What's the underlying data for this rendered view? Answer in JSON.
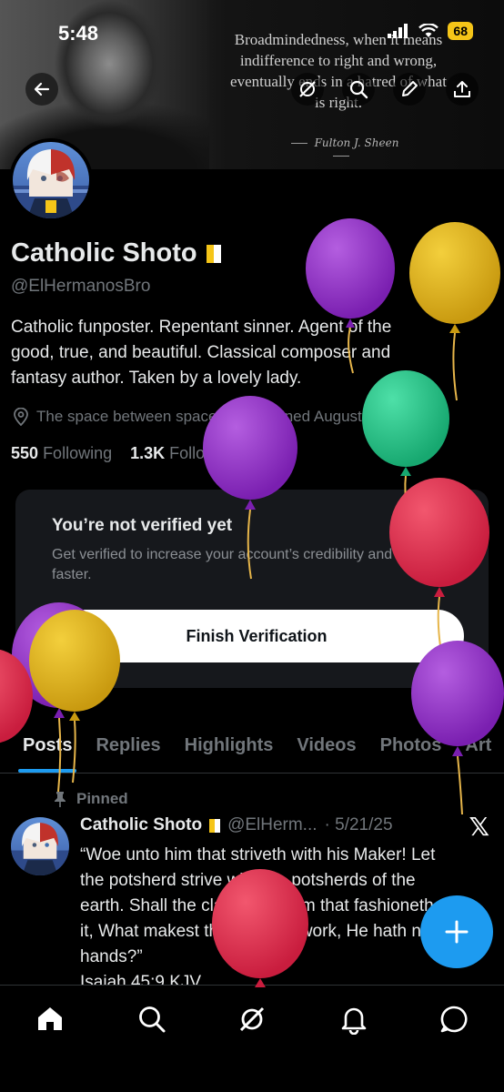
{
  "status": {
    "time": "5:48",
    "battery": "68"
  },
  "banner": {
    "quote_lines": [
      "Broadmindedness, when it means",
      "indifference to right and wrong,",
      "eventually ends in a hatred of what",
      "is right."
    ],
    "author": "Fulton J. Sheen"
  },
  "profile": {
    "name": "Catholic Shoto",
    "handle": "@ElHermanosBro",
    "bio_lines": [
      "Catholic funposter. Repentant sinner. Agent of the",
      "good, true, and beautiful. Classical composer and",
      "fantasy author. Taken by a lovely lady."
    ],
    "location": "The space between spaces",
    "joined": "Joined August 2021",
    "following_count": "550",
    "following_label": "Following",
    "followers_count": "1.3K",
    "followers_label": "Followers"
  },
  "verify_card": {
    "title": "You’re not verified yet",
    "description": "Get verified to increase your account’s credibility and grow faster.",
    "button": "Finish Verification"
  },
  "tabs": [
    {
      "label": "Posts",
      "active": true
    },
    {
      "label": "Replies"
    },
    {
      "label": "Highlights"
    },
    {
      "label": "Videos"
    },
    {
      "label": "Photos"
    },
    {
      "label": "Art"
    }
  ],
  "post": {
    "pinned_label": "Pinned",
    "author": "Catholic Shoto",
    "handle": "@ElHerm...",
    "date": "· 5/21/25",
    "lines": [
      "“Woe unto him that striveth with his Maker! Let",
      "the potsherd strive with the potsherds of the",
      "earth. Shall the clay say to him that fashioneth",
      "it, What makest thou? or thy work, He hath no",
      "hands?”",
      "Isaiah 45:9 KJV"
    ]
  },
  "icons": [
    "back-icon",
    "grok-icon",
    "search-icon",
    "edit-icon",
    "share-icon",
    "location-icon",
    "calendar-icon",
    "pin-icon",
    "x-logo-icon",
    "plus-icon",
    "home-icon",
    "explore-icon",
    "grok-tab-icon",
    "notifications-icon",
    "messages-icon"
  ],
  "colors": {
    "accent": "#1d9bf0",
    "background": "#000000",
    "card": "#16181c",
    "muted": "#71767b",
    "battery": "#f5c518"
  }
}
